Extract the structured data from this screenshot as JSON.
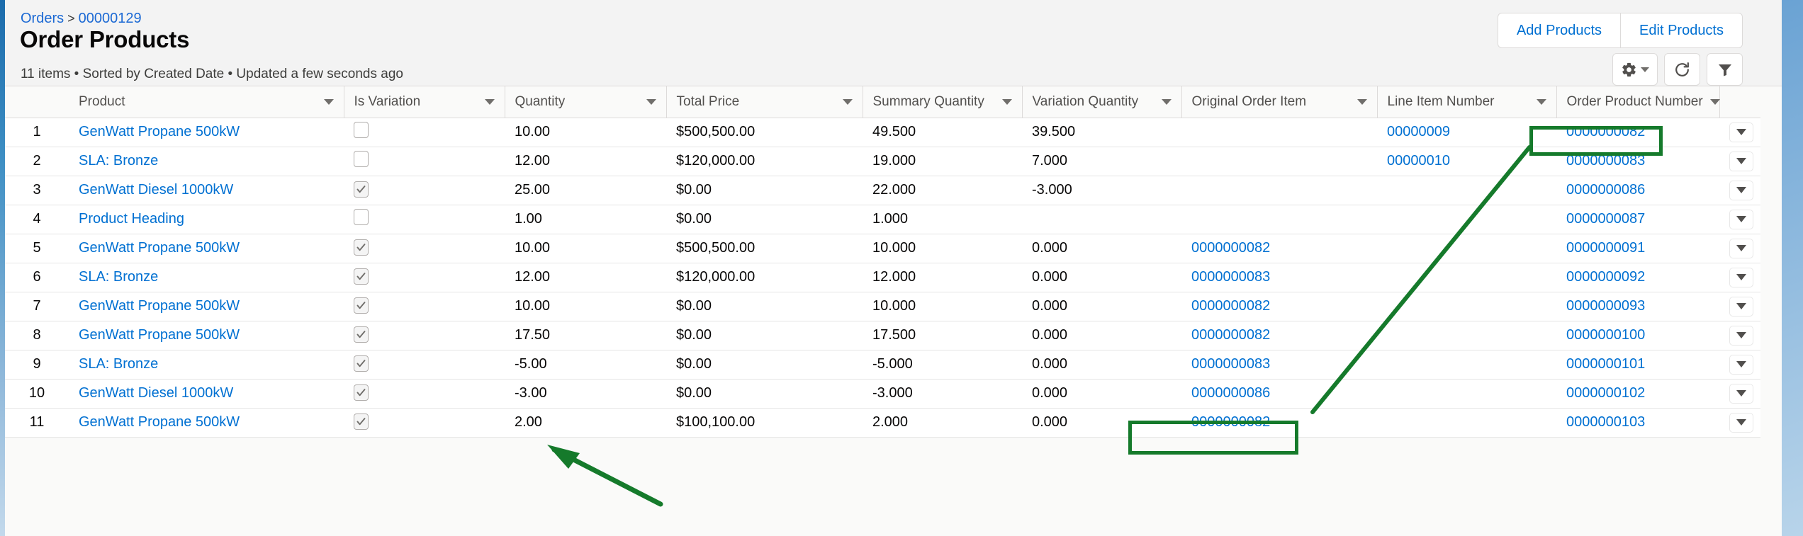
{
  "header": {
    "breadcrumb": {
      "parent": "Orders",
      "separator": ">",
      "current": "00000129"
    },
    "title": "Order Products",
    "meta": "11 items • Sorted by Created Date • Updated a few seconds ago",
    "buttons": {
      "add": "Add Products",
      "edit": "Edit Products"
    },
    "icon_buttons": {
      "settings": "gear-icon",
      "refresh": "refresh-icon",
      "filter": "filter-icon"
    }
  },
  "table": {
    "columns": [
      {
        "key": "row",
        "label": ""
      },
      {
        "key": "product",
        "label": "Product"
      },
      {
        "key": "is_variation",
        "label": "Is Variation"
      },
      {
        "key": "quantity",
        "label": "Quantity"
      },
      {
        "key": "total_price",
        "label": "Total Price"
      },
      {
        "key": "summary_quantity",
        "label": "Summary Quantity"
      },
      {
        "key": "variation_quantity",
        "label": "Variation Quantity"
      },
      {
        "key": "original_order_item",
        "label": "Original Order Item"
      },
      {
        "key": "line_item_number",
        "label": "Line Item Number"
      },
      {
        "key": "order_product_number",
        "label": "Order Product Number"
      },
      {
        "key": "actions",
        "label": ""
      }
    ],
    "rows": [
      {
        "row": "1",
        "product": "GenWatt Propane 500kW",
        "is_variation": false,
        "quantity": "10.00",
        "total_price": "$500,500.00",
        "summary_quantity": "49.500",
        "variation_quantity": "39.500",
        "original_order_item": "",
        "line_item_number": "00000009",
        "order_product_number": "0000000082"
      },
      {
        "row": "2",
        "product": "SLA: Bronze",
        "is_variation": false,
        "quantity": "12.00",
        "total_price": "$120,000.00",
        "summary_quantity": "19.000",
        "variation_quantity": "7.000",
        "original_order_item": "",
        "line_item_number": "00000010",
        "order_product_number": "0000000083"
      },
      {
        "row": "3",
        "product": "GenWatt Diesel 1000kW",
        "is_variation": true,
        "quantity": "25.00",
        "total_price": "$0.00",
        "summary_quantity": "22.000",
        "variation_quantity": "-3.000",
        "original_order_item": "",
        "line_item_number": "",
        "order_product_number": "0000000086"
      },
      {
        "row": "4",
        "product": "Product Heading",
        "is_variation": false,
        "quantity": "1.00",
        "total_price": "$0.00",
        "summary_quantity": "1.000",
        "variation_quantity": "",
        "original_order_item": "",
        "line_item_number": "",
        "order_product_number": "0000000087"
      },
      {
        "row": "5",
        "product": "GenWatt Propane 500kW",
        "is_variation": true,
        "quantity": "10.00",
        "total_price": "$500,500.00",
        "summary_quantity": "10.000",
        "variation_quantity": "0.000",
        "original_order_item": "0000000082",
        "line_item_number": "",
        "order_product_number": "0000000091"
      },
      {
        "row": "6",
        "product": "SLA: Bronze",
        "is_variation": true,
        "quantity": "12.00",
        "total_price": "$120,000.00",
        "summary_quantity": "12.000",
        "variation_quantity": "0.000",
        "original_order_item": "0000000083",
        "line_item_number": "",
        "order_product_number": "0000000092"
      },
      {
        "row": "7",
        "product": "GenWatt Propane 500kW",
        "is_variation": true,
        "quantity": "10.00",
        "total_price": "$0.00",
        "summary_quantity": "10.000",
        "variation_quantity": "0.000",
        "original_order_item": "0000000082",
        "line_item_number": "",
        "order_product_number": "0000000093"
      },
      {
        "row": "8",
        "product": "GenWatt Propane 500kW",
        "is_variation": true,
        "quantity": "17.50",
        "total_price": "$0.00",
        "summary_quantity": "17.500",
        "variation_quantity": "0.000",
        "original_order_item": "0000000082",
        "line_item_number": "",
        "order_product_number": "0000000100"
      },
      {
        "row": "9",
        "product": "SLA: Bronze",
        "is_variation": true,
        "quantity": "-5.00",
        "total_price": "$0.00",
        "summary_quantity": "-5.000",
        "variation_quantity": "0.000",
        "original_order_item": "0000000083",
        "line_item_number": "",
        "order_product_number": "0000000101"
      },
      {
        "row": "10",
        "product": "GenWatt Diesel 1000kW",
        "is_variation": true,
        "quantity": "-3.00",
        "total_price": "$0.00",
        "summary_quantity": "-3.000",
        "variation_quantity": "0.000",
        "original_order_item": "0000000086",
        "line_item_number": "",
        "order_product_number": "0000000102"
      },
      {
        "row": "11",
        "product": "GenWatt Propane 500kW",
        "is_variation": true,
        "quantity": "2.00",
        "total_price": "$100,100.00",
        "summary_quantity": "2.000",
        "variation_quantity": "0.000",
        "original_order_item": "0000000082",
        "line_item_number": "",
        "order_product_number": "0000000103"
      }
    ]
  },
  "annotations": {
    "color": "#157a2b",
    "highlight_boxes": [
      {
        "name": "order-product-number-row-1",
        "value": "0000000082"
      },
      {
        "name": "original-order-item-row-11",
        "value": "0000000082"
      }
    ],
    "arrow_target": "quantity-row-11"
  },
  "colors": {
    "link": "#0070d2",
    "header_bg": "#f3f3f3",
    "annotation_green": "#157a2b"
  }
}
